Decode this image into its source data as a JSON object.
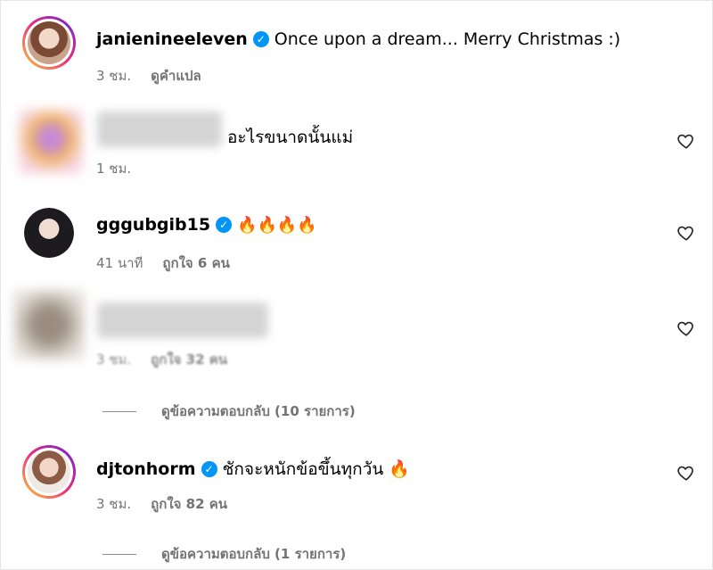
{
  "comments": [
    {
      "username": "janienineeleven",
      "verified": true,
      "text": "Once upon a dream... Merry Christmas :)",
      "time": "3 ชม.",
      "action": "ดูคำแปล"
    },
    {
      "username": "",
      "text": "อะไรขนาดนั้นแม่",
      "time": "1 ชม."
    },
    {
      "username": "gggubgib15",
      "verified": true,
      "text": "🔥🔥🔥🔥",
      "time": "41 นาที",
      "likes": "ถูกใจ 6 คน"
    },
    {
      "username": "",
      "text": "",
      "time": "3 ชม.",
      "likes": "ถูกใจ 32 คน",
      "replies": "ดูข้อความตอบกลับ (10 รายการ)"
    },
    {
      "username": "djtonhorm",
      "verified": true,
      "text": "ชักจะหนักข้อขึ้นทุกวัน 🔥",
      "time": "3 ชม.",
      "likes": "ถูกใจ 82 คน",
      "replies": "ดูข้อความตอบกลับ (1 รายการ)"
    }
  ],
  "icons": {
    "verified": "verified-badge-icon",
    "like": "heart-outline-icon"
  },
  "colors": {
    "verified": "#0095f6",
    "meta_text": "#737373"
  }
}
